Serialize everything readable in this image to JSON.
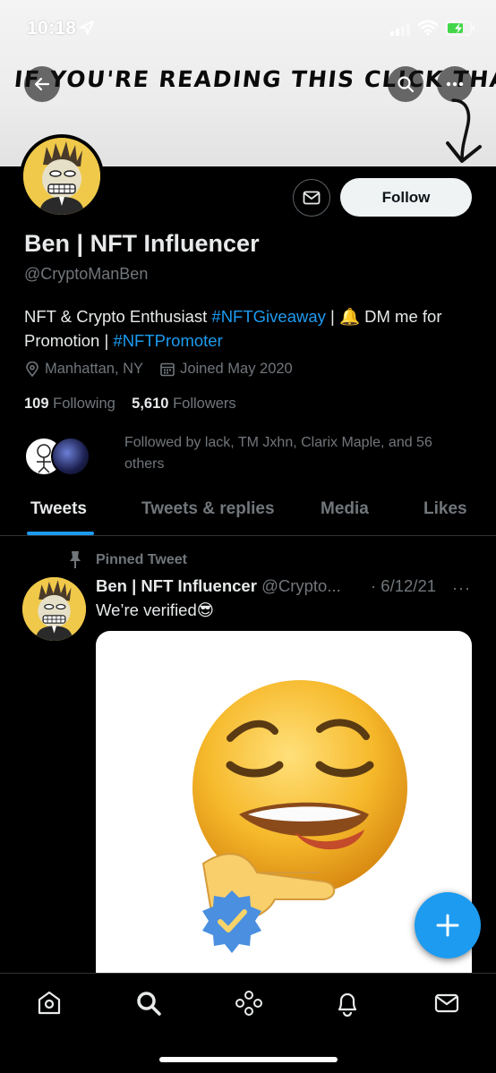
{
  "status_bar": {
    "time": "10:18"
  },
  "banner": {
    "handwritten_text": "IF YOU'RE READING THIS CLICK THAT"
  },
  "profile": {
    "follow_label": "Follow",
    "name": "Ben | NFT Influencer",
    "handle": "@CryptoManBen",
    "bio": {
      "part1": "NFT & Crypto Enthusiast ",
      "tag1": "#NFTGiveaway",
      "part2": " | 🔔 DM me for Promotion | ",
      "tag2": "#NFTPromoter"
    },
    "location": "Manhattan, NY",
    "joined": "Joined May 2020",
    "following_count": "109",
    "following_label": "Following",
    "followers_count": "5,610",
    "followers_label": "Followers",
    "followed_by": "Followed by lack, TM Jxhn, Clarix Maple, and 56 others"
  },
  "tabs": [
    "Tweets",
    "Tweets & replies",
    "Media",
    "Likes"
  ],
  "pinned_tweet": {
    "pinned_label": "Pinned Tweet",
    "author_name": "Ben | NFT Influencer",
    "author_handle": "@Crypto...",
    "date": "· 6/12/21",
    "more": "···",
    "text": "We’re verified😎"
  },
  "icons": {
    "status": [
      "location-arrow-icon",
      "signal-icon",
      "wifi-icon",
      "battery-charging-icon"
    ],
    "banner": [
      "back-icon",
      "search-icon",
      "more-icon"
    ],
    "bottom_nav": [
      "home-icon",
      "search-icon",
      "spaces-icon",
      "notifications-icon",
      "messages-icon"
    ]
  },
  "colors": {
    "accent": "#1d9bf0",
    "background": "#000000",
    "secondary_text": "#71767b",
    "avatar_bg": "#f0c94b"
  }
}
